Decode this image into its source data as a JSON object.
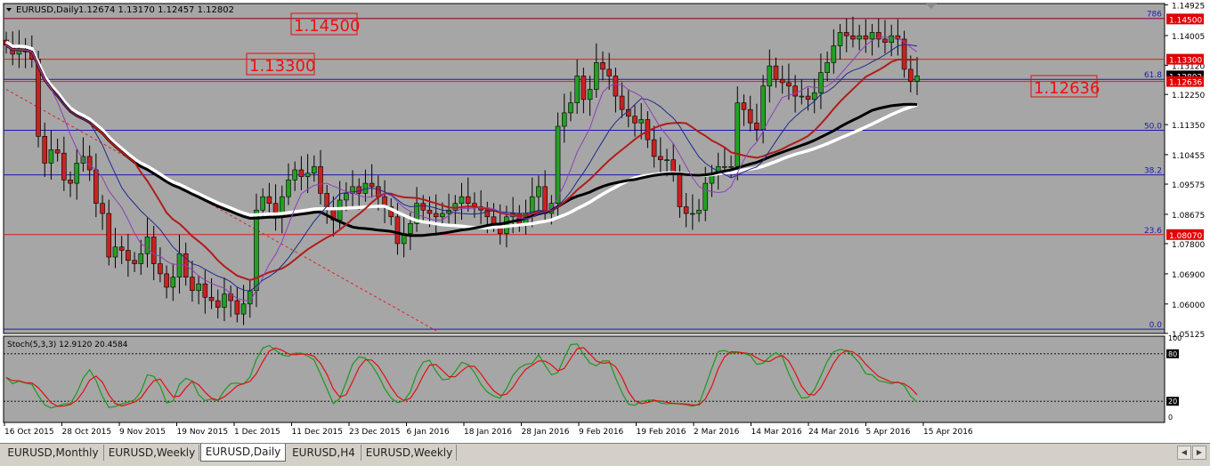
{
  "window": {
    "symbol_line": "EURUSD,Daily",
    "ohlc": "1.12674 1.13170 1.12457 1.12802",
    "stoch_label": "Stoch(5,3,3) 12.9120 20.4584"
  },
  "annotations": {
    "big_1": "1.14500",
    "big_2": "1.13300",
    "big_3": "1.12636"
  },
  "fib_labels": [
    "786",
    "61.8",
    "50.0",
    "38.2",
    "23.6",
    "0.0"
  ],
  "tabs": [
    {
      "label": "EURUSD,Monthly",
      "active": false
    },
    {
      "label": "EURUSD,Weekly",
      "active": false
    },
    {
      "label": "EURUSD,Daily",
      "active": true
    },
    {
      "label": "EURUSD,H4",
      "active": false
    },
    {
      "label": "EURUSD,Weekly",
      "active": false
    }
  ],
  "colors": {
    "background": "#a6a6a6",
    "bull_candle": "#22a022",
    "bear_candle": "#cc2020",
    "red_line": "#dd1c1c",
    "blue_line": "#1a1aa8",
    "price_tag": "#e00000"
  },
  "chart_data": {
    "type": "candlestick",
    "symbol": "EURUSD",
    "timeframe": "Daily",
    "ylim": [
      1.0512,
      1.1496
    ],
    "yticks": [
      "1.14925",
      "1.14005",
      "1.13120",
      "1.12250",
      "1.11350",
      "1.10455",
      "1.09575",
      "1.08675",
      "1.07800",
      "1.06900",
      "1.06000",
      "1.05125"
    ],
    "price_tags": [
      {
        "label": "1.14500",
        "value": 1.145,
        "type": "red"
      },
      {
        "label": "1.13300",
        "value": 1.133,
        "type": "red"
      },
      {
        "label": "1.12802",
        "value": 1.12802,
        "type": "current"
      },
      {
        "label": "1.12636",
        "value": 1.12636,
        "type": "red"
      },
      {
        "label": "1.08070",
        "value": 1.0807,
        "type": "red"
      }
    ],
    "horizontal_lines": [
      {
        "value": 1.1452,
        "color": "blue",
        "fib": "786"
      },
      {
        "value": 1.1451,
        "color": "red"
      },
      {
        "value": 1.133,
        "color": "red"
      },
      {
        "value": 1.127,
        "color": "blue",
        "fib": "61.8"
      },
      {
        "value": 1.12636,
        "color": "red"
      },
      {
        "value": 1.1118,
        "color": "blue",
        "fib": "50.0"
      },
      {
        "value": 1.0985,
        "color": "blue",
        "fib": "38.2"
      },
      {
        "value": 1.0807,
        "color": "red",
        "fib": "23.6"
      },
      {
        "value": 1.0525,
        "color": "blue",
        "fib": "0.0"
      }
    ],
    "xtick_labels": [
      "16 Oct 2015",
      "28 Oct 2015",
      "9 Nov 2015",
      "19 Nov 2015",
      "1 Dec 2015",
      "11 Dec 2015",
      "23 Dec 2015",
      "6 Jan 2016",
      "18 Jan 2016",
      "28 Jan 2016",
      "9 Feb 2016",
      "19 Feb 2016",
      "2 Mar 2016",
      "14 Mar 2016",
      "24 Mar 2016",
      "5 Apr 2016",
      "15 Apr 2016"
    ],
    "closes": [
      1.1372,
      1.1345,
      1.136,
      1.1352,
      1.133,
      1.11,
      1.102,
      1.106,
      1.105,
      1.097,
      1.096,
      1.102,
      1.104,
      1.1,
      1.09,
      1.087,
      1.074,
      1.077,
      1.076,
      1.073,
      1.072,
      1.075,
      1.08,
      1.072,
      1.069,
      1.065,
      1.068,
      1.075,
      1.068,
      1.064,
      1.066,
      1.062,
      1.061,
      1.059,
      1.063,
      1.061,
      1.057,
      1.06,
      1.064,
      1.088,
      1.092,
      1.09,
      1.086,
      1.092,
      1.097,
      1.1,
      1.098,
      1.099,
      1.101,
      1.093,
      1.088,
      1.085,
      1.091,
      1.093,
      1.095,
      1.093,
      1.096,
      1.095,
      1.092,
      1.089,
      1.086,
      1.078,
      1.081,
      1.084,
      1.09,
      1.088,
      1.087,
      1.086,
      1.087,
      1.088,
      1.09,
      1.092,
      1.09,
      1.089,
      1.088,
      1.086,
      1.084,
      1.081,
      1.086,
      1.087,
      1.084,
      1.087,
      1.092,
      1.095,
      1.087,
      1.09,
      1.113,
      1.117,
      1.12,
      1.128,
      1.121,
      1.124,
      1.132,
      1.13,
      1.128,
      1.122,
      1.118,
      1.116,
      1.114,
      1.115,
      1.109,
      1.104,
      1.103,
      1.103,
      1.099,
      1.089,
      1.087,
      1.087,
      1.088,
      1.096,
      1.099,
      1.101,
      1.101,
      1.101,
      1.12,
      1.118,
      1.114,
      1.112,
      1.125,
      1.131,
      1.127,
      1.126,
      1.125,
      1.122,
      1.122,
      1.121,
      1.123,
      1.129,
      1.132,
      1.137,
      1.141,
      1.14,
      1.139,
      1.14,
      1.139,
      1.141,
      1.139,
      1.138,
      1.14,
      1.139,
      1.13,
      1.1264,
      1.128
    ]
  }
}
